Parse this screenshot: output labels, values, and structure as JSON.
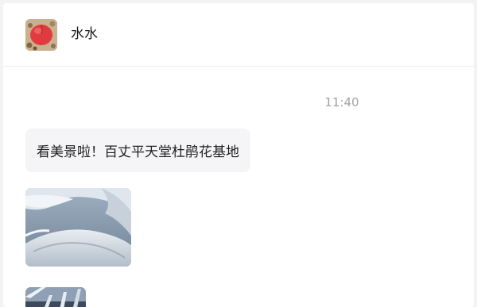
{
  "contact": {
    "name": "水水"
  },
  "messages": [
    {
      "time": "11:40",
      "text": "看美景啦！百丈平天堂杜鹃花基地"
    }
  ],
  "icons": {
    "avatar": "peach-avatar-image",
    "photo1": "snowy-mountain-photo",
    "photo2": "frosted-branches-photo"
  },
  "colors": {
    "bubble_bg": "#f5f5f7",
    "timestamp": "#a3a3a3"
  }
}
